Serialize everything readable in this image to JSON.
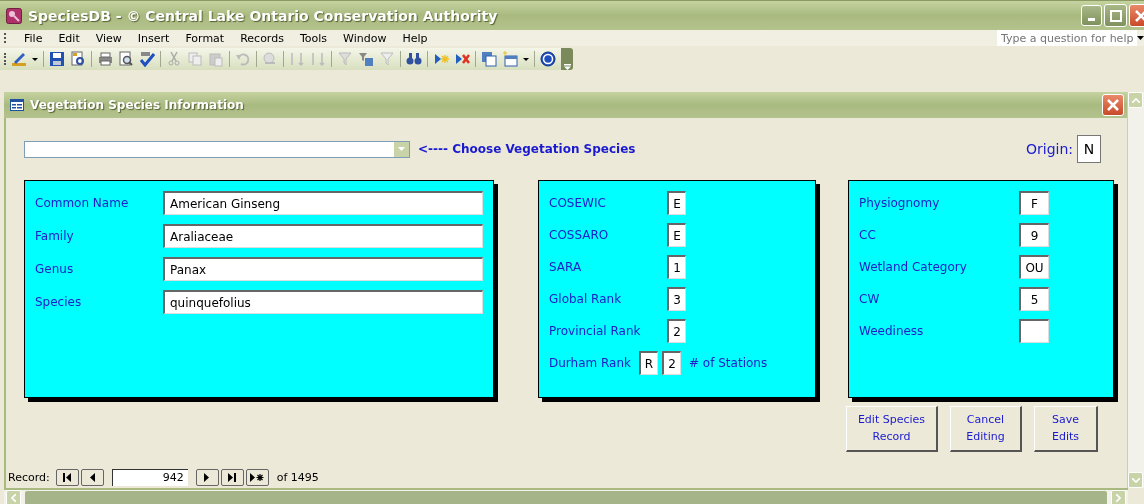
{
  "window": {
    "title": "SpeciesDB - © Central Lake Ontario Conservation Authority"
  },
  "menu": [
    "File",
    "Edit",
    "View",
    "Insert",
    "Format",
    "Records",
    "Tools",
    "Window",
    "Help"
  ],
  "help_box": {
    "placeholder": "Type a question for help"
  },
  "form": {
    "title": "Vegetation Species Information",
    "species_picker": {
      "label": "<---- Choose Vegetation Species"
    },
    "origin": {
      "label": "Origin:",
      "value": "N"
    },
    "names_panel": [
      {
        "label": "Common Name",
        "value": "American Ginseng"
      },
      {
        "label": "Family",
        "value": "Araliaceae"
      },
      {
        "label": "Genus",
        "value": "Panax"
      },
      {
        "label": "Species",
        "value": "quinquefolius"
      }
    ],
    "status_panel": [
      {
        "label": "COSEWIC",
        "values": [
          "E"
        ]
      },
      {
        "label": "COSSARO",
        "values": [
          "E"
        ]
      },
      {
        "label": "SARA",
        "values": [
          "1"
        ]
      },
      {
        "label": "Global Rank",
        "values": [
          "3"
        ]
      },
      {
        "label": "Provincial Rank",
        "values": [
          "2"
        ]
      },
      {
        "label": "Durham Rank",
        "values": [
          "R",
          "2"
        ],
        "suffix": "# of Stations"
      }
    ],
    "traits_panel": [
      {
        "label": "Physiognomy",
        "value": "F"
      },
      {
        "label": "CC",
        "value": "9"
      },
      {
        "label": "Wetland Category",
        "value": "OU"
      },
      {
        "label": "CW",
        "value": "5"
      },
      {
        "label": "Weediness"
      }
    ],
    "buttons": [
      "Edit Species Record",
      "Cancel Editing",
      "Save Edits"
    ]
  },
  "record_nav": {
    "label": "Record:",
    "current": "942",
    "total": "of 1495"
  }
}
